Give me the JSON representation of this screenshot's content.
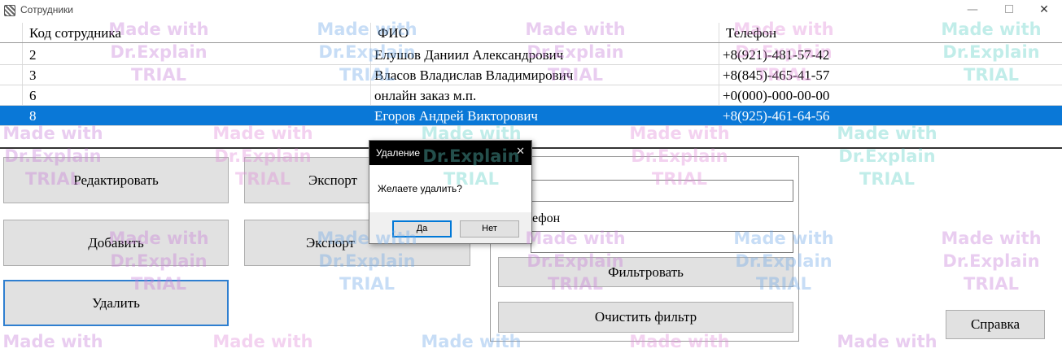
{
  "window": {
    "title": "Сотрудники",
    "min_glyph": "—",
    "close_glyph": "✕"
  },
  "grid": {
    "columns": [
      "Код сотрудника",
      "ФИО",
      "Телефон"
    ],
    "rows": [
      {
        "code": "2",
        "name": "Елушов Даниил Александрович",
        "phone": "+8(921)-481-57-42",
        "selected": false
      },
      {
        "code": "3",
        "name": "Власов Владислав Владимирович",
        "phone": "+8(845)-465-41-57",
        "selected": false
      },
      {
        "code": "6",
        "name": "онлайн заказ м.п.",
        "phone": "+0(000)-000-00-00",
        "selected": false
      },
      {
        "code": "8",
        "name": "Егоров Андрей Викторович",
        "phone": "+8(925)-461-64-56",
        "selected": true
      }
    ]
  },
  "buttons": {
    "edit": "Редактировать",
    "add": "Добавить",
    "delete": "Удалить",
    "export1": "Экспорт",
    "export2": "Экспорт",
    "filter": "Фильтровать",
    "clear_filter": "Очистить фильтр",
    "help": "Справка"
  },
  "filter": {
    "phone_label": "ефон",
    "name_value": "",
    "phone_value": ""
  },
  "dialog": {
    "title": "Удаление",
    "message": "Желаете удалить?",
    "yes": "Да",
    "no": "Нет",
    "close_glyph": "✕"
  },
  "watermark": {
    "line1": "Made with",
    "line2": "Dr.Explain",
    "line3": "TRIAL"
  }
}
